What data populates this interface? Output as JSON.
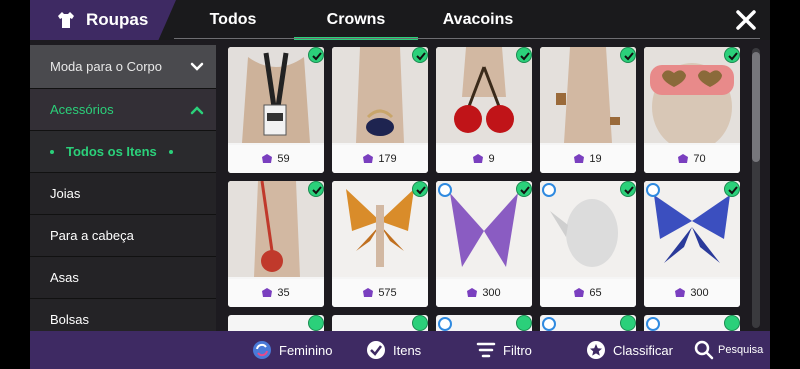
{
  "header": {
    "section_title": "Roupas",
    "tabs": [
      {
        "label": "Todos",
        "active": false
      },
      {
        "label": "Crowns",
        "active": true
      },
      {
        "label": "Avacoins",
        "active": false
      }
    ]
  },
  "sidebar": {
    "items": [
      {
        "label": "Moda para o Corpo"
      },
      {
        "label": "Acessórios"
      },
      {
        "label": "Todos os Itens"
      },
      {
        "label": "Joias"
      },
      {
        "label": "Para a cabeça"
      },
      {
        "label": "Asas"
      },
      {
        "label": "Bolsas"
      }
    ]
  },
  "items": [
    {
      "price": "59"
    },
    {
      "price": "179"
    },
    {
      "price": "9"
    },
    {
      "price": "19"
    },
    {
      "price": "70"
    },
    {
      "price": "35"
    },
    {
      "price": "575"
    },
    {
      "price": "300"
    },
    {
      "price": "65"
    },
    {
      "price": "300"
    }
  ],
  "bottom": {
    "feminino": "Feminino",
    "itens": "Itens",
    "filtro": "Filtro",
    "classificar": "Classificar",
    "pesquisa": "Pesquisa"
  },
  "colors": {
    "accent": "#2bd07a",
    "bar": "#3e2a63",
    "panel": "#1d1b20"
  }
}
